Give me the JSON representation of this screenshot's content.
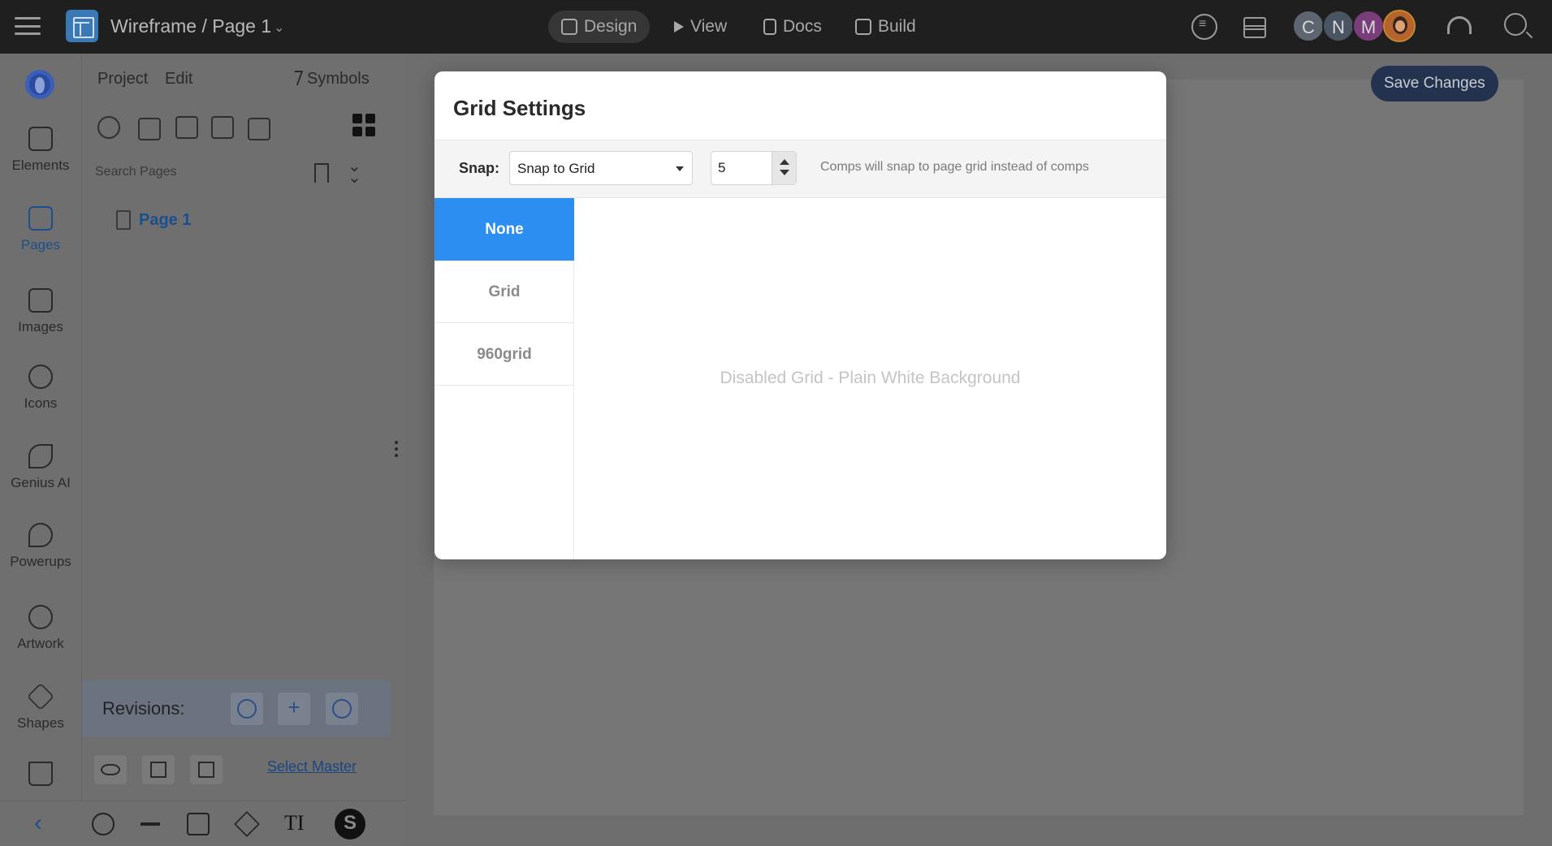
{
  "topbar": {
    "doc_title": "Wireframe / Page 1",
    "tabs": [
      "Design",
      "View",
      "Docs",
      "Build"
    ],
    "active_tab": "Design",
    "avatars": [
      "C",
      "N",
      "M"
    ]
  },
  "rail": {
    "items": [
      {
        "label": "Elements",
        "icon": "cube-icon"
      },
      {
        "label": "Pages",
        "icon": "pages-icon",
        "active": true
      },
      {
        "label": "Images",
        "icon": "image-icon"
      },
      {
        "label": "Icons",
        "icon": "smiley-icon"
      },
      {
        "label": "Genius AI",
        "icon": "sparkle-icon"
      },
      {
        "label": "Powerups",
        "icon": "rocket-icon"
      },
      {
        "label": "Artwork",
        "icon": "ball-icon"
      },
      {
        "label": "Shapes",
        "icon": "diamond-icon"
      }
    ]
  },
  "panel": {
    "menu_project": "Project",
    "menu_edit": "Edit",
    "menu_symbols": "Symbols",
    "search_placeholder": "Search Pages",
    "page_item": "Page 1",
    "revisions_label": "Revisions:",
    "select_master": "Select Master"
  },
  "canvas": {
    "save_label": "Save Changes"
  },
  "modal": {
    "title": "Grid Settings",
    "snap_label": "Snap:",
    "snap_value": "Snap to Grid",
    "snap_number": "5",
    "snap_help": "Comps will snap to page grid instead of comps",
    "options": [
      "None",
      "Grid",
      "960grid"
    ],
    "selected_option": "None",
    "preview_text": "Disabled Grid - Plain White Background"
  },
  "colors": {
    "accent": "#2b8ef0",
    "topbar": "#1f1f1f",
    "save_button": "#22324f"
  }
}
